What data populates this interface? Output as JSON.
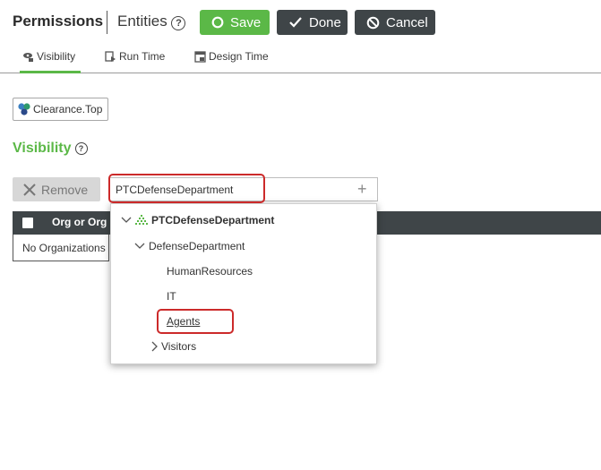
{
  "header": {
    "title": "Permissions",
    "entities_label": "Entities",
    "help_glyph": "?",
    "save_label": "Save",
    "done_label": "Done",
    "cancel_label": "Cancel"
  },
  "tabs": [
    {
      "label": "Visibility",
      "icon": "eye-lock-icon",
      "active": true
    },
    {
      "label": "Run Time",
      "icon": "runtime-icon",
      "active": false
    },
    {
      "label": "Design Time",
      "icon": "design-time-icon",
      "active": false
    }
  ],
  "clearance": {
    "label": "Clearance.Top",
    "icon": "hexagon-cluster-icon"
  },
  "visibility": {
    "heading": "Visibility",
    "help_glyph": "?"
  },
  "toolbar": {
    "remove_label": "Remove",
    "search_value": "PTCDefenseDepartment",
    "add_glyph": "+"
  },
  "table": {
    "column_header": "Org or Org",
    "empty_text": "No Organizations"
  },
  "dropdown": {
    "root": "PTCDefenseDepartment",
    "department": "DefenseDepartment",
    "children": [
      "HumanResources",
      "IT",
      "Agents"
    ],
    "visitors": "Visitors"
  },
  "colors": {
    "accent_green": "#5bb847",
    "dark_button": "#3f4548",
    "highlight_red": "#cc2a2a"
  }
}
